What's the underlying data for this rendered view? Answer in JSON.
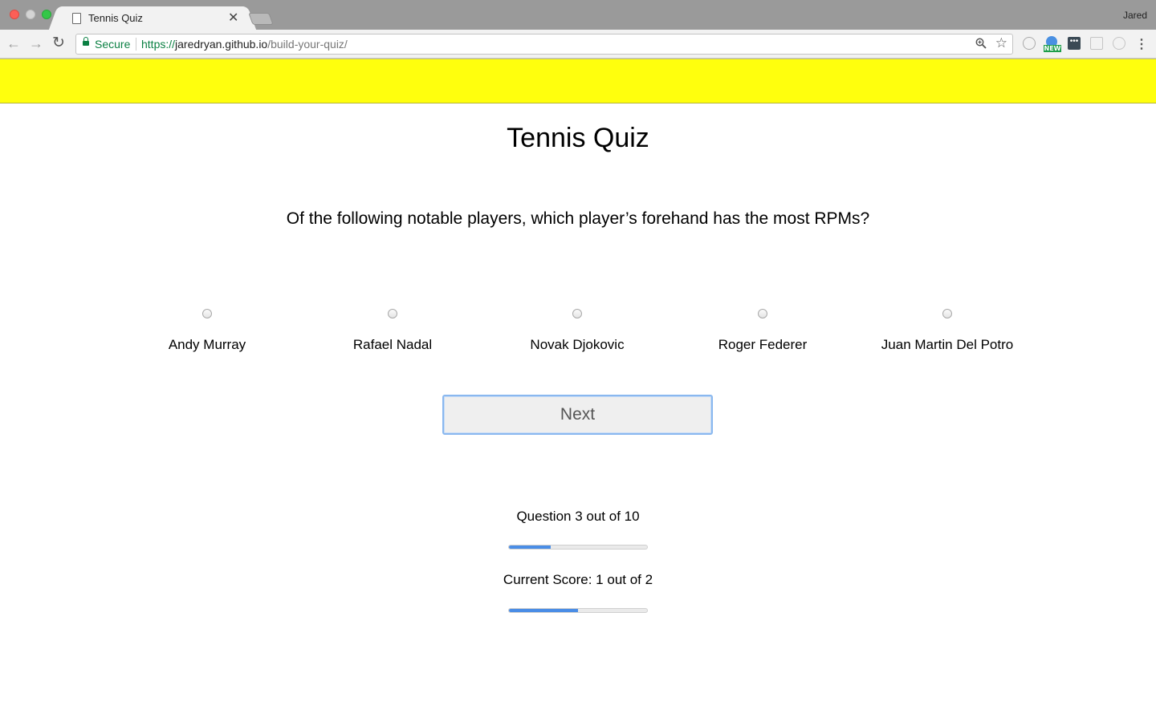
{
  "browser": {
    "tab_title": "Tennis Quiz",
    "profile_name": "Jared",
    "secure_label": "Secure",
    "url_scheme": "https://",
    "url_host": "jaredryan.github.io",
    "url_path": "/build-your-quiz/",
    "extension_badge": "NEW",
    "icons": [
      "back-icon",
      "forward-icon",
      "reload-icon",
      "lock-icon",
      "zoom-icon",
      "star-icon",
      "menu-icon"
    ]
  },
  "quiz": {
    "title": "Tennis Quiz",
    "question": "Of the following notable players, which player’s forehand has the most RPMs?",
    "answers": [
      "Andy Murray",
      "Rafael Nadal",
      "Novak Djokovic",
      "Roger Federer",
      "Juan Martin Del Potro"
    ],
    "next_label": "Next",
    "progress_text": "Question 3 out of 10",
    "progress_fraction": 0.3,
    "score_text": "Current Score: 1 out of 2",
    "score_fraction": 0.5
  },
  "colors": {
    "banner": "#ffff0d",
    "progress_fill": "#4a8de6",
    "secure_green": "#0b8043"
  }
}
